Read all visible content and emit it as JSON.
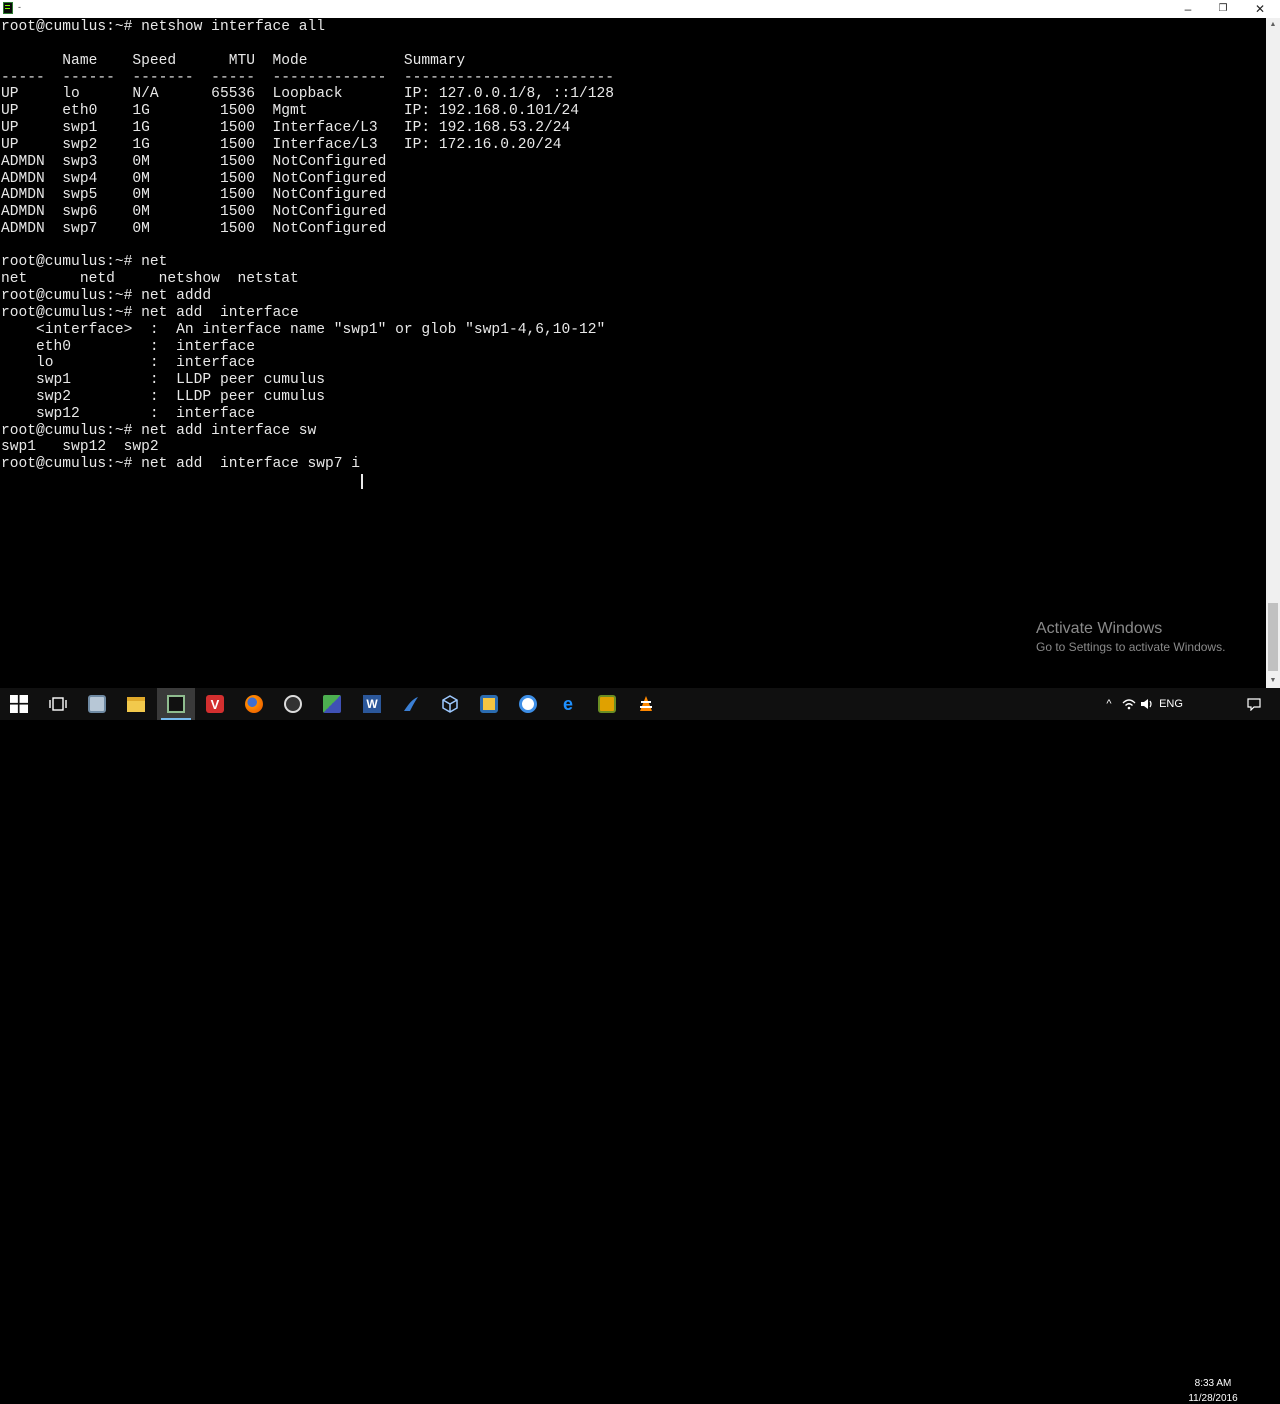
{
  "window": {
    "title": "-",
    "controls": {
      "minimize": "–",
      "maximize": "❐",
      "close": "✕"
    }
  },
  "terminal": {
    "lines": [
      "root@cumulus:~# netshow interface all",
      "",
      "       Name    Speed      MTU  Mode           Summary",
      "-----  ------  -------  -----  -------------  ------------------------",
      "UP     lo      N/A      65536  Loopback       IP: 127.0.0.1/8, ::1/128",
      "UP     eth0    1G        1500  Mgmt           IP: 192.168.0.101/24",
      "UP     swp1    1G        1500  Interface/L3   IP: 192.168.53.2/24",
      "UP     swp2    1G        1500  Interface/L3   IP: 172.16.0.20/24",
      "ADMDN  swp3    0M        1500  NotConfigured",
      "ADMDN  swp4    0M        1500  NotConfigured",
      "ADMDN  swp5    0M        1500  NotConfigured",
      "ADMDN  swp6    0M        1500  NotConfigured",
      "ADMDN  swp7    0M        1500  NotConfigured",
      "",
      "root@cumulus:~# net",
      "net      netd     netshow  netstat",
      "root@cumulus:~# net addd",
      "root@cumulus:~# net add  interface",
      "    <interface>  :  An interface name \"swp1\" or glob \"swp1-4,6,10-12\"",
      "    eth0         :  interface",
      "    lo           :  interface",
      "    swp1         :  LLDP peer cumulus",
      "    swp2         :  LLDP peer cumulus",
      "    swp12        :  interface",
      "root@cumulus:~# net add interface sw",
      "swp1   swp12  swp2",
      "root@cumulus:~# net add  interface swp7 i"
    ]
  },
  "watermark": {
    "title": "Activate Windows",
    "subtitle": "Go to Settings to activate Windows."
  },
  "scrollbar": {
    "up": "▲",
    "down": "▼"
  },
  "taskbar": {
    "apps": [
      {
        "name": "start-button",
        "icon": "windows-logo-icon",
        "active": false
      },
      {
        "name": "task-view-button",
        "icon": "task-view-icon",
        "active": false
      },
      {
        "name": "taskbar-app-network",
        "icon": "network-app-icon",
        "active": false
      },
      {
        "name": "taskbar-app-file-explorer",
        "icon": "folder-icon",
        "active": false
      },
      {
        "name": "taskbar-app-terminal",
        "icon": "terminal-icon",
        "active": true
      },
      {
        "name": "taskbar-app-vivaldi",
        "icon": "vivaldi-icon",
        "active": false
      },
      {
        "name": "taskbar-app-firefox",
        "icon": "firefox-icon",
        "active": false
      },
      {
        "name": "taskbar-app-chrome-like",
        "icon": "aperture-icon",
        "active": false
      },
      {
        "name": "taskbar-app-network-tool",
        "icon": "network-tool-icon",
        "active": false
      },
      {
        "name": "taskbar-app-word",
        "icon": "word-icon",
        "active": false
      },
      {
        "name": "taskbar-app-wireshark",
        "icon": "wireshark-icon",
        "active": false
      },
      {
        "name": "taskbar-app-virtualbox",
        "icon": "cube-icon",
        "active": false
      },
      {
        "name": "taskbar-app-notes",
        "icon": "notes-icon",
        "active": false
      },
      {
        "name": "taskbar-app-internet-explorer",
        "icon": "ie-icon",
        "active": false
      },
      {
        "name": "taskbar-app-edge",
        "icon": "edge-icon",
        "active": false
      },
      {
        "name": "taskbar-app-tools",
        "icon": "tools-icon",
        "active": false
      },
      {
        "name": "taskbar-app-vlc",
        "icon": "vlc-icon",
        "active": false
      }
    ],
    "tray": {
      "chevron": "^",
      "language": "ENG",
      "time": "8:33 AM",
      "date": "11/28/2016"
    }
  }
}
